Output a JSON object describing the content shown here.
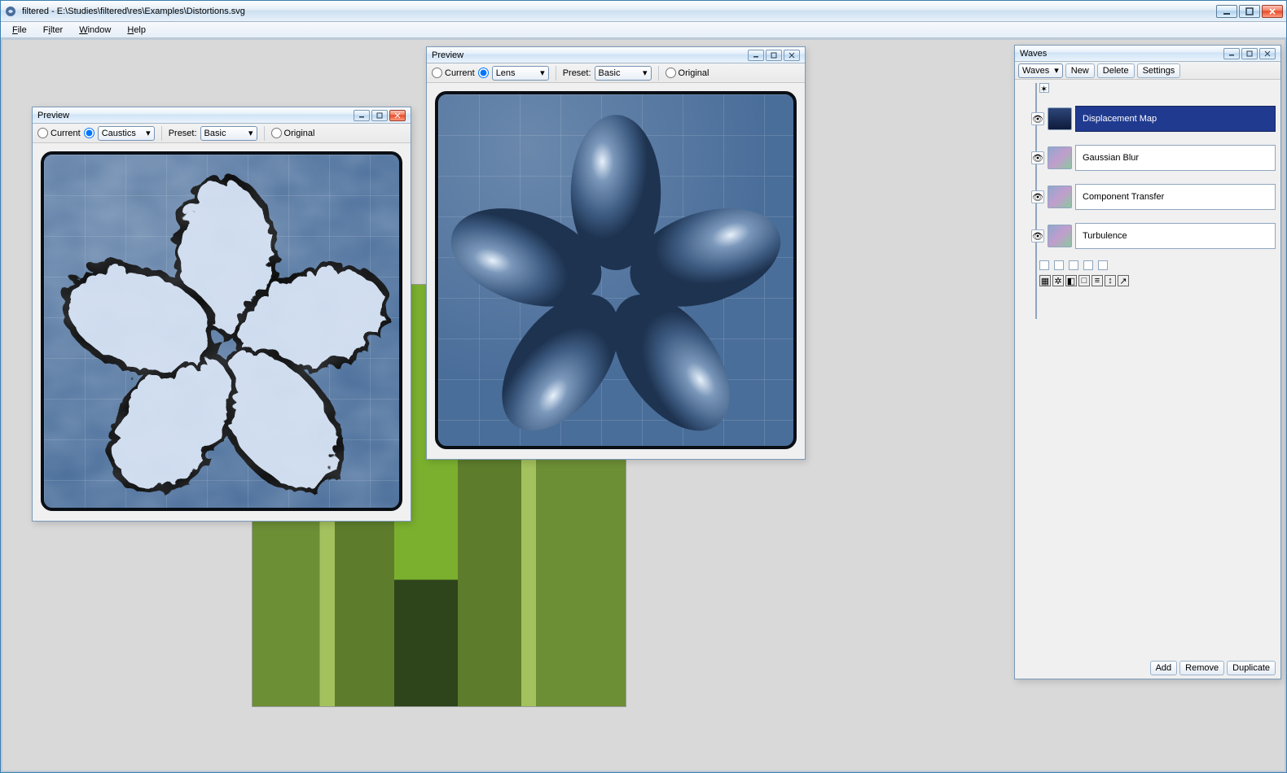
{
  "window": {
    "title": "filtered - E:\\Studies\\filtered\\res\\Examples\\Distortions.svg"
  },
  "menu": {
    "file": "File",
    "filter": "Filter",
    "window": "Window",
    "help": "Help"
  },
  "preview_labels": {
    "title": "Preview",
    "current": "Current",
    "preset": "Preset:",
    "original": "Original"
  },
  "preview1": {
    "mode": "Caustics",
    "preset_value": "Basic"
  },
  "preview2": {
    "mode": "Lens",
    "preset_value": "Basic"
  },
  "waves": {
    "title": "Waves",
    "dropdown": "Waves",
    "new": "New",
    "delete": "Delete",
    "settings": "Settings",
    "nodes": [
      {
        "label": "Displacement Map",
        "selected": true
      },
      {
        "label": "Gaussian Blur",
        "selected": false
      },
      {
        "label": "Component Transfer",
        "selected": false
      },
      {
        "label": "Turbulence",
        "selected": false
      }
    ],
    "footer": {
      "add": "Add",
      "remove": "Remove",
      "duplicate": "Duplicate"
    }
  }
}
